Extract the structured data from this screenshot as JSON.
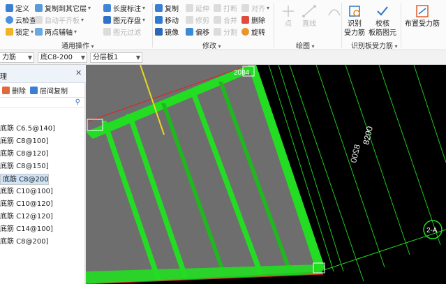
{
  "ribbon": {
    "col1": [
      {
        "label": "定义",
        "icon": "define-icon"
      },
      {
        "label": "云检查",
        "icon": "cloud-check-icon"
      },
      {
        "label": "锁定",
        "icon": "lock-icon",
        "dropdown": true
      }
    ],
    "col2": [
      {
        "label": "复制到其它层",
        "icon": "copy-to-layer-icon",
        "dropdown": true
      },
      {
        "label": "自动平齐板",
        "icon": "auto-align-icon",
        "dropdown": true,
        "disabled": true
      },
      {
        "label": "两点辅轴",
        "icon": "two-point-axis-icon",
        "dropdown": true
      }
    ],
    "col3": [
      {
        "label": "长度标注",
        "icon": "length-dim-icon",
        "dropdown": true
      },
      {
        "label": "图元存盘",
        "icon": "save-element-icon",
        "dropdown": true
      },
      {
        "label": "图元过滤",
        "icon": "filter-element-icon",
        "disabled": true
      }
    ],
    "general_group": "通用操作",
    "col4": [
      {
        "label": "复制",
        "icon": "copy-icon"
      },
      {
        "label": "移动",
        "icon": "move-icon"
      },
      {
        "label": "镜像",
        "icon": "mirror-icon"
      }
    ],
    "col5": [
      {
        "label": "延伸",
        "icon": "extend-icon",
        "disabled": true
      },
      {
        "label": "修剪",
        "icon": "trim-icon",
        "disabled": true
      },
      {
        "label": "偏移",
        "icon": "offset-icon"
      }
    ],
    "col6": [
      {
        "label": "打断",
        "icon": "break-icon",
        "disabled": true
      },
      {
        "label": "合并",
        "icon": "merge-icon",
        "disabled": true
      },
      {
        "label": "分割",
        "icon": "split-icon",
        "disabled": true
      }
    ],
    "col7": [
      {
        "label": "对齐",
        "icon": "align-icon",
        "dropdown": true,
        "disabled": true
      },
      {
        "label": "删除",
        "icon": "delete-icon"
      },
      {
        "label": "旋转",
        "icon": "rotate-icon"
      }
    ],
    "modify_group": "修改",
    "draw_point": "点",
    "draw_line": "直线",
    "draw_group": "绘图",
    "identify_rebar": "识别\n受力筋",
    "verify_rebar": "校核\n板筋图元",
    "identify_group": "识别板受力筋",
    "place_rebar": "布置受力筋"
  },
  "selectors": {
    "type": "力筋",
    "name": "底C8-200",
    "layer": "分层板1"
  },
  "panel": {
    "title": "理",
    "delete": "删除",
    "copy_layer": "层间复制",
    "items": [
      "底筋 C6.5@140]",
      "底筋 C8@100]",
      "底筋 C8@120]",
      "底筋 C8@150]",
      "底筋 C8@200]",
      "底筋 C10@100]",
      "底筋 C10@120]",
      "底筋 C12@120]",
      "底筋 C14@100]",
      "底筋 C8@200]"
    ],
    "selected_index": 4
  },
  "canvas": {
    "dim_label": "8200",
    "dim_label_mirror": "8200",
    "top_label": "2084",
    "right_label": "2-A"
  },
  "colors": {
    "green": "#22dd22",
    "red": "#e02020",
    "yellow": "#e8d820",
    "slab_gray": "#6e6e6e",
    "selected_row": "#cde3f7"
  }
}
